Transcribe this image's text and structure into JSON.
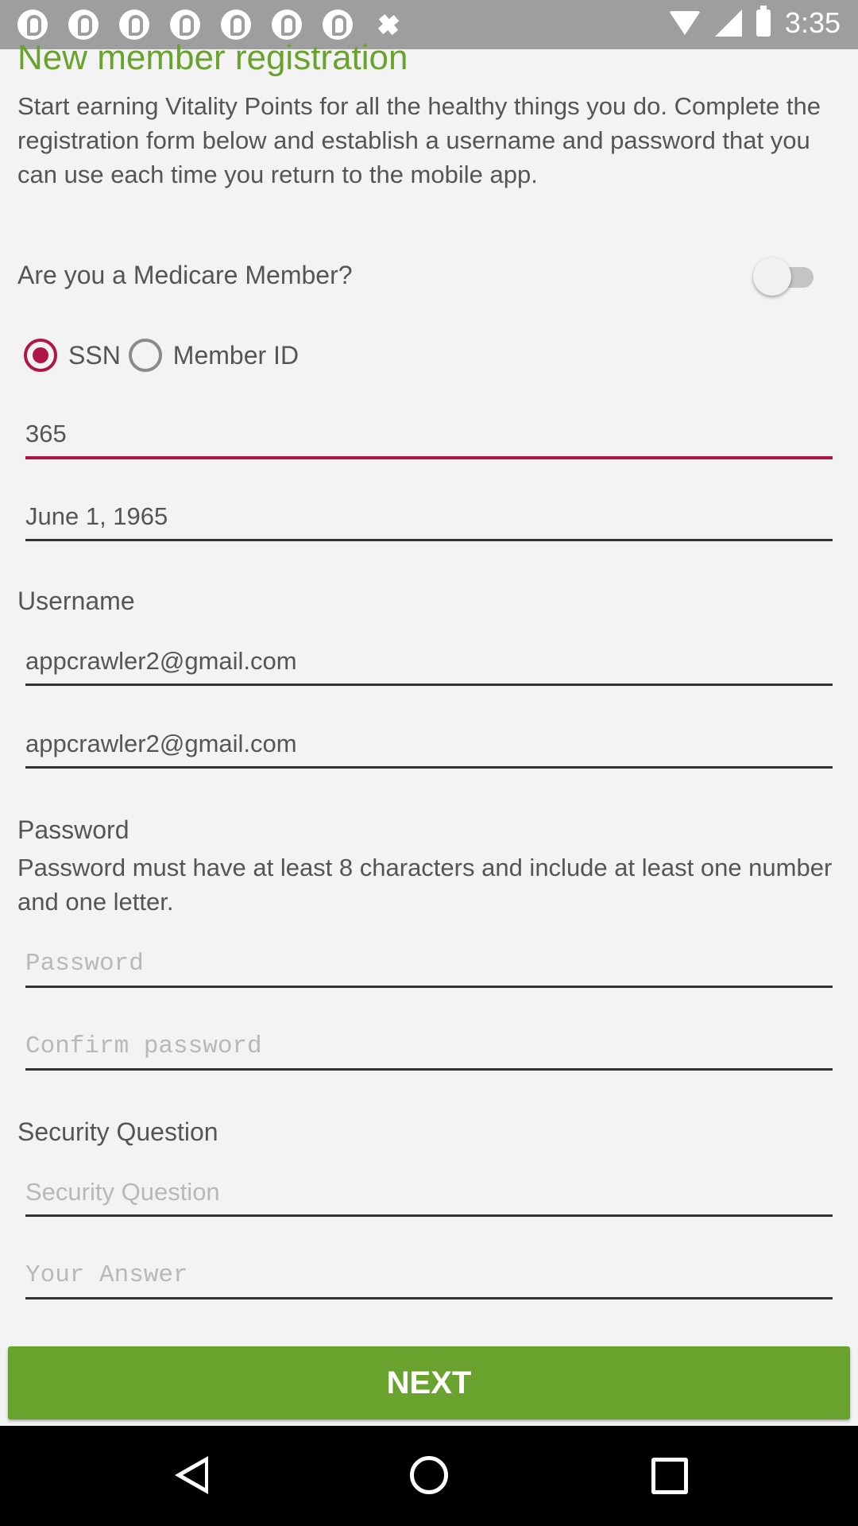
{
  "status_bar": {
    "time": "3:35",
    "notification_icons": [
      "pinterest-icon",
      "pinterest-icon",
      "pinterest-icon",
      "pinterest-icon",
      "pinterest-icon",
      "pinterest-icon",
      "pinterest-icon",
      "satellite-icon"
    ]
  },
  "header": {
    "title": "New member registration",
    "intro": "Start earning Vitality Points for all the healthy things you do. Complete the registration form below and establish a username and password that you can use each time you return to the mobile app."
  },
  "medicare": {
    "label": "Are you a Medicare Member?",
    "toggle_on": false
  },
  "id_type": {
    "options": [
      "SSN",
      "Member ID"
    ],
    "selected": "SSN"
  },
  "fields": {
    "ssn_value": "365",
    "dob_value": "June 1, 1965"
  },
  "username": {
    "label": "Username",
    "value": "appcrawler2@gmail.com",
    "confirm_value": "appcrawler2@gmail.com"
  },
  "password": {
    "label": "Password",
    "help": "Password must have at least 8 characters and include at least one number and one letter.",
    "placeholder": "Password",
    "confirm_placeholder": "Confirm password"
  },
  "security": {
    "label": "Security Question",
    "question_placeholder": "Security Question",
    "answer_placeholder": "Your Answer"
  },
  "actions": {
    "next_label": "NEXT"
  },
  "colors": {
    "accent_green": "#6aa22e",
    "accent_magenta": "#b0154a",
    "status_bar": "#9e9e9e",
    "background": "#f3f3f3"
  }
}
